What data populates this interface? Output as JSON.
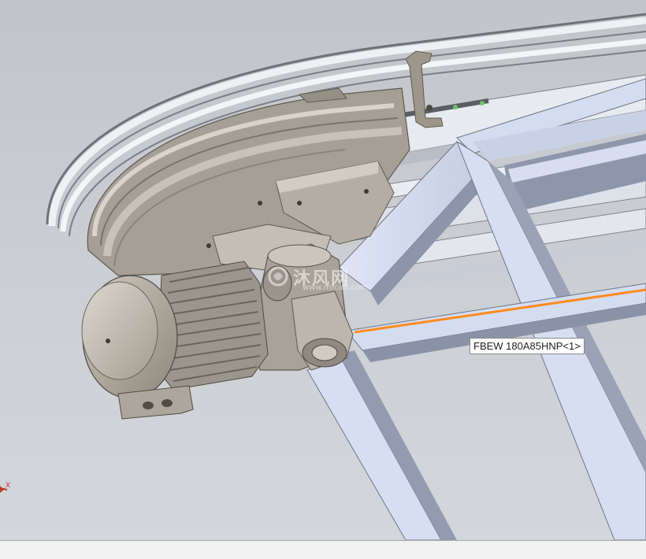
{
  "viewport": {
    "part_tooltip": "FBEW 180A85HNP<1>",
    "watermark": {
      "main": "沐风网",
      "sub": "www.mfcad.com"
    },
    "triad_axis_label": "X"
  },
  "colors": {
    "background": "#c7c9ce",
    "frame_face": "#d4dcf0",
    "frame_side": "#8e96ab",
    "motor_body": "#b5afa5",
    "selection_edge": "#ff8a1a",
    "rail": "#eceef2"
  },
  "statusbar": {}
}
